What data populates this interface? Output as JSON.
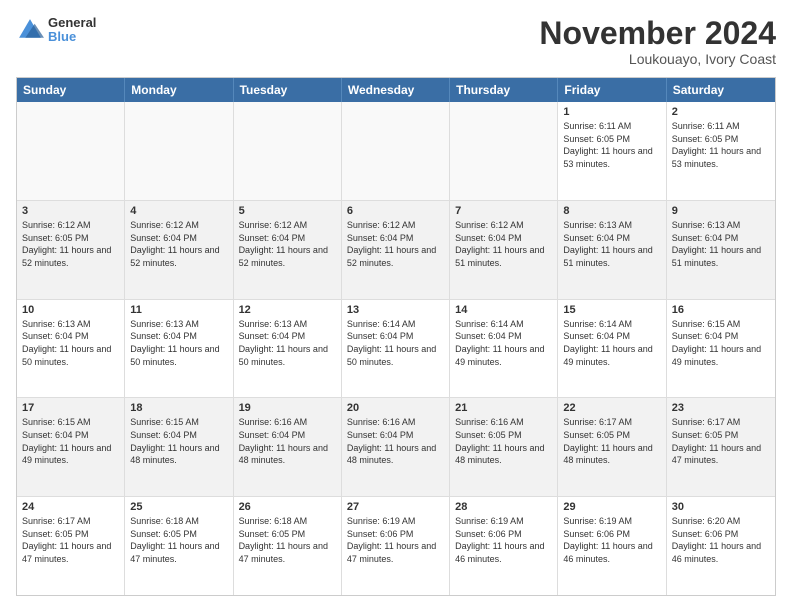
{
  "header": {
    "logo": {
      "line1": "General",
      "line2": "Blue"
    },
    "title": "November 2024",
    "subtitle": "Loukouayo, Ivory Coast"
  },
  "calendar": {
    "days_of_week": [
      "Sunday",
      "Monday",
      "Tuesday",
      "Wednesday",
      "Thursday",
      "Friday",
      "Saturday"
    ],
    "weeks": [
      {
        "cells": [
          {
            "day": "",
            "empty": true
          },
          {
            "day": "",
            "empty": true
          },
          {
            "day": "",
            "empty": true
          },
          {
            "day": "",
            "empty": true
          },
          {
            "day": "",
            "empty": true
          },
          {
            "day": "1",
            "sunrise": "Sunrise: 6:11 AM",
            "sunset": "Sunset: 6:05 PM",
            "daylight": "Daylight: 11 hours and 53 minutes."
          },
          {
            "day": "2",
            "sunrise": "Sunrise: 6:11 AM",
            "sunset": "Sunset: 6:05 PM",
            "daylight": "Daylight: 11 hours and 53 minutes."
          }
        ]
      },
      {
        "cells": [
          {
            "day": "3",
            "sunrise": "Sunrise: 6:12 AM",
            "sunset": "Sunset: 6:05 PM",
            "daylight": "Daylight: 11 hours and 52 minutes."
          },
          {
            "day": "4",
            "sunrise": "Sunrise: 6:12 AM",
            "sunset": "Sunset: 6:04 PM",
            "daylight": "Daylight: 11 hours and 52 minutes."
          },
          {
            "day": "5",
            "sunrise": "Sunrise: 6:12 AM",
            "sunset": "Sunset: 6:04 PM",
            "daylight": "Daylight: 11 hours and 52 minutes."
          },
          {
            "day": "6",
            "sunrise": "Sunrise: 6:12 AM",
            "sunset": "Sunset: 6:04 PM",
            "daylight": "Daylight: 11 hours and 52 minutes."
          },
          {
            "day": "7",
            "sunrise": "Sunrise: 6:12 AM",
            "sunset": "Sunset: 6:04 PM",
            "daylight": "Daylight: 11 hours and 51 minutes."
          },
          {
            "day": "8",
            "sunrise": "Sunrise: 6:13 AM",
            "sunset": "Sunset: 6:04 PM",
            "daylight": "Daylight: 11 hours and 51 minutes."
          },
          {
            "day": "9",
            "sunrise": "Sunrise: 6:13 AM",
            "sunset": "Sunset: 6:04 PM",
            "daylight": "Daylight: 11 hours and 51 minutes."
          }
        ]
      },
      {
        "cells": [
          {
            "day": "10",
            "sunrise": "Sunrise: 6:13 AM",
            "sunset": "Sunset: 6:04 PM",
            "daylight": "Daylight: 11 hours and 50 minutes."
          },
          {
            "day": "11",
            "sunrise": "Sunrise: 6:13 AM",
            "sunset": "Sunset: 6:04 PM",
            "daylight": "Daylight: 11 hours and 50 minutes."
          },
          {
            "day": "12",
            "sunrise": "Sunrise: 6:13 AM",
            "sunset": "Sunset: 6:04 PM",
            "daylight": "Daylight: 11 hours and 50 minutes."
          },
          {
            "day": "13",
            "sunrise": "Sunrise: 6:14 AM",
            "sunset": "Sunset: 6:04 PM",
            "daylight": "Daylight: 11 hours and 50 minutes."
          },
          {
            "day": "14",
            "sunrise": "Sunrise: 6:14 AM",
            "sunset": "Sunset: 6:04 PM",
            "daylight": "Daylight: 11 hours and 49 minutes."
          },
          {
            "day": "15",
            "sunrise": "Sunrise: 6:14 AM",
            "sunset": "Sunset: 6:04 PM",
            "daylight": "Daylight: 11 hours and 49 minutes."
          },
          {
            "day": "16",
            "sunrise": "Sunrise: 6:15 AM",
            "sunset": "Sunset: 6:04 PM",
            "daylight": "Daylight: 11 hours and 49 minutes."
          }
        ]
      },
      {
        "cells": [
          {
            "day": "17",
            "sunrise": "Sunrise: 6:15 AM",
            "sunset": "Sunset: 6:04 PM",
            "daylight": "Daylight: 11 hours and 49 minutes."
          },
          {
            "day": "18",
            "sunrise": "Sunrise: 6:15 AM",
            "sunset": "Sunset: 6:04 PM",
            "daylight": "Daylight: 11 hours and 48 minutes."
          },
          {
            "day": "19",
            "sunrise": "Sunrise: 6:16 AM",
            "sunset": "Sunset: 6:04 PM",
            "daylight": "Daylight: 11 hours and 48 minutes."
          },
          {
            "day": "20",
            "sunrise": "Sunrise: 6:16 AM",
            "sunset": "Sunset: 6:04 PM",
            "daylight": "Daylight: 11 hours and 48 minutes."
          },
          {
            "day": "21",
            "sunrise": "Sunrise: 6:16 AM",
            "sunset": "Sunset: 6:05 PM",
            "daylight": "Daylight: 11 hours and 48 minutes."
          },
          {
            "day": "22",
            "sunrise": "Sunrise: 6:17 AM",
            "sunset": "Sunset: 6:05 PM",
            "daylight": "Daylight: 11 hours and 48 minutes."
          },
          {
            "day": "23",
            "sunrise": "Sunrise: 6:17 AM",
            "sunset": "Sunset: 6:05 PM",
            "daylight": "Daylight: 11 hours and 47 minutes."
          }
        ]
      },
      {
        "cells": [
          {
            "day": "24",
            "sunrise": "Sunrise: 6:17 AM",
            "sunset": "Sunset: 6:05 PM",
            "daylight": "Daylight: 11 hours and 47 minutes."
          },
          {
            "day": "25",
            "sunrise": "Sunrise: 6:18 AM",
            "sunset": "Sunset: 6:05 PM",
            "daylight": "Daylight: 11 hours and 47 minutes."
          },
          {
            "day": "26",
            "sunrise": "Sunrise: 6:18 AM",
            "sunset": "Sunset: 6:05 PM",
            "daylight": "Daylight: 11 hours and 47 minutes."
          },
          {
            "day": "27",
            "sunrise": "Sunrise: 6:19 AM",
            "sunset": "Sunset: 6:06 PM",
            "daylight": "Daylight: 11 hours and 47 minutes."
          },
          {
            "day": "28",
            "sunrise": "Sunrise: 6:19 AM",
            "sunset": "Sunset: 6:06 PM",
            "daylight": "Daylight: 11 hours and 46 minutes."
          },
          {
            "day": "29",
            "sunrise": "Sunrise: 6:19 AM",
            "sunset": "Sunset: 6:06 PM",
            "daylight": "Daylight: 11 hours and 46 minutes."
          },
          {
            "day": "30",
            "sunrise": "Sunrise: 6:20 AM",
            "sunset": "Sunset: 6:06 PM",
            "daylight": "Daylight: 11 hours and 46 minutes."
          }
        ]
      }
    ]
  }
}
